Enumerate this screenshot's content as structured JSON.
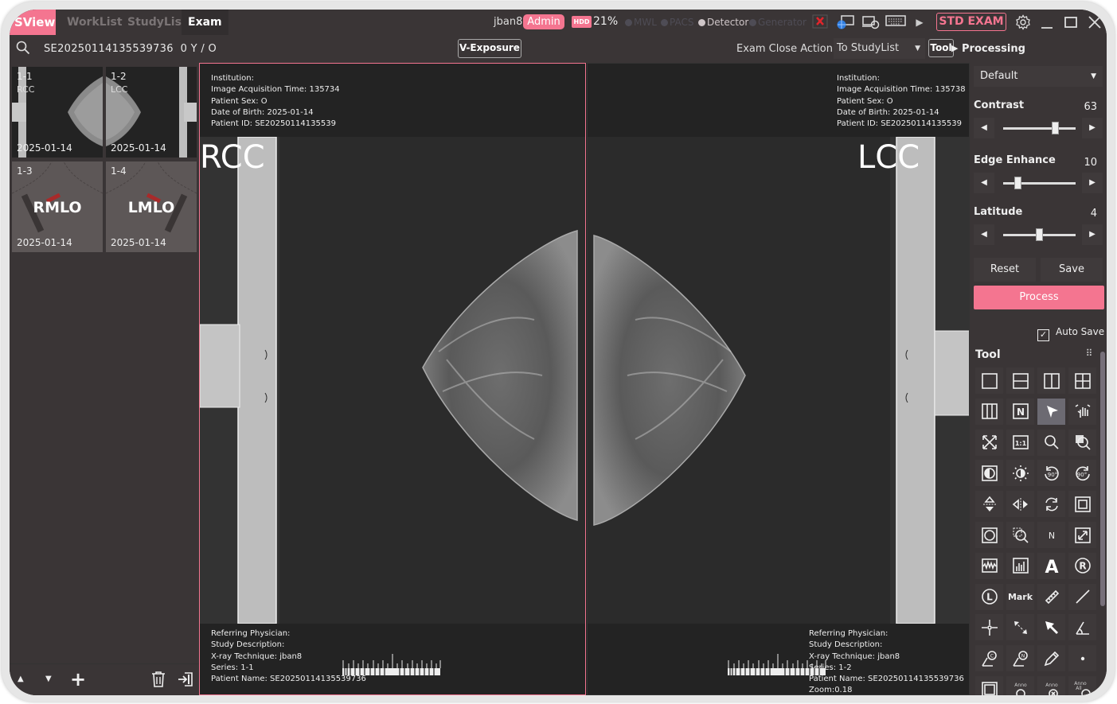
{
  "app": {
    "logo": "SView",
    "accent": "#f47590"
  },
  "nav": {
    "tabs": [
      {
        "label": "WorkList",
        "active": false
      },
      {
        "label": "StudyList",
        "active": false
      },
      {
        "label": "Exam",
        "active": true
      }
    ]
  },
  "status": {
    "user": "jban8",
    "role": "Admin",
    "hdd_label": "HDD",
    "hdd_value": "21%",
    "connections": [
      {
        "label": "MWL",
        "on": false
      },
      {
        "label": "PACS",
        "on": false
      },
      {
        "label": "Detector",
        "on": true
      },
      {
        "label": "Generator",
        "on": false
      }
    ],
    "std_exam": "STD EXAM"
  },
  "toolbar": {
    "study_id": "SE20250114135539736",
    "study_info": "0 Y / O",
    "v_exposure": "V-Exposure",
    "exam_close_action_label": "Exam Close Action",
    "exam_close_action_value": "To StudyList",
    "tool_button": "Tool",
    "processing_label": "Processing"
  },
  "thumbnails": [
    {
      "num": "1-1",
      "view": "RCC",
      "date": "2025-01-14",
      "selected": true,
      "acquired": true
    },
    {
      "num": "1-2",
      "view": "LCC",
      "date": "2025-01-14",
      "selected": false,
      "acquired": true
    },
    {
      "num": "1-3",
      "view": "RMLO",
      "date": "2025-01-14",
      "selected": false,
      "acquired": false
    },
    {
      "num": "1-4",
      "view": "LMLO",
      "date": "2025-01-14",
      "selected": false,
      "acquired": false
    }
  ],
  "viewports": [
    {
      "label": "RCC",
      "top_info": "Institution:\nImage Acquisition Time: 135734\nPatient Sex: O\nDate of Birth: 2025-01-14\nPatient ID: SE20250114135539",
      "bottom_info": "Referring Physician:\nStudy Description:\nX-ray Technique: jban8\nSeries: 1-1\nPatient Name: SE20250114135539736"
    },
    {
      "label": "LCC",
      "top_info": "Institution:\nImage Acquisition Time: 135738\nPatient Sex: O\nDate of Birth: 2025-01-14\nPatient ID: SE20250114135539",
      "bottom_info": "Referring Physician:\nStudy Description:\nX-ray Technique: jban8\nSeries: 1-2\nPatient Name: SE20250114135539736\nZoom:0.18"
    }
  ],
  "processing": {
    "preset": "Default",
    "sliders": [
      {
        "label": "Contrast",
        "value": "63",
        "fraction": 0.72
      },
      {
        "label": "Edge Enhance",
        "value": "10",
        "fraction": 0.2
      },
      {
        "label": "Latitude",
        "value": "4",
        "fraction": 0.5
      }
    ],
    "reset": "Reset",
    "save": "Save",
    "process": "Process",
    "auto_save": "Auto Save",
    "auto_save_checked": true
  },
  "tools": {
    "header": "Tool",
    "items": [
      "layout-1x1",
      "layout-2-rows",
      "layout-2-cols",
      "layout-2x2",
      "layout-3-cols",
      "layout-n",
      "select-pointer",
      "pan-hand",
      "fit-screen",
      "actual-size-1-1",
      "zoom",
      "magnify",
      "invert",
      "brightness",
      "rotate-left-90",
      "rotate-right-90",
      "flip-vertical",
      "flip-horizontal",
      "reset-rotate",
      "frame",
      "circle-roi",
      "zoom-region",
      "n-label",
      "stretch",
      "histogram-wave",
      "histogram-bars",
      "text-annotation",
      "right-marker",
      "left-marker",
      "mark",
      "ruler",
      "line",
      "crosshair",
      "arrow-measure",
      "arrow",
      "angle",
      "cobb-angle",
      "n-angle",
      "pencil",
      "dot",
      "rectangle",
      "anno-show",
      "anno-delete",
      "anno-all-delete"
    ],
    "active": "select-pointer",
    "mark_label": "Mark",
    "n_label": "N",
    "ratio_label": "1:1",
    "anno_label": "Anno",
    "anno_all_label": "Anno All"
  },
  "left_bottom": {
    "up": "▲",
    "down": "▼",
    "add": "+"
  }
}
